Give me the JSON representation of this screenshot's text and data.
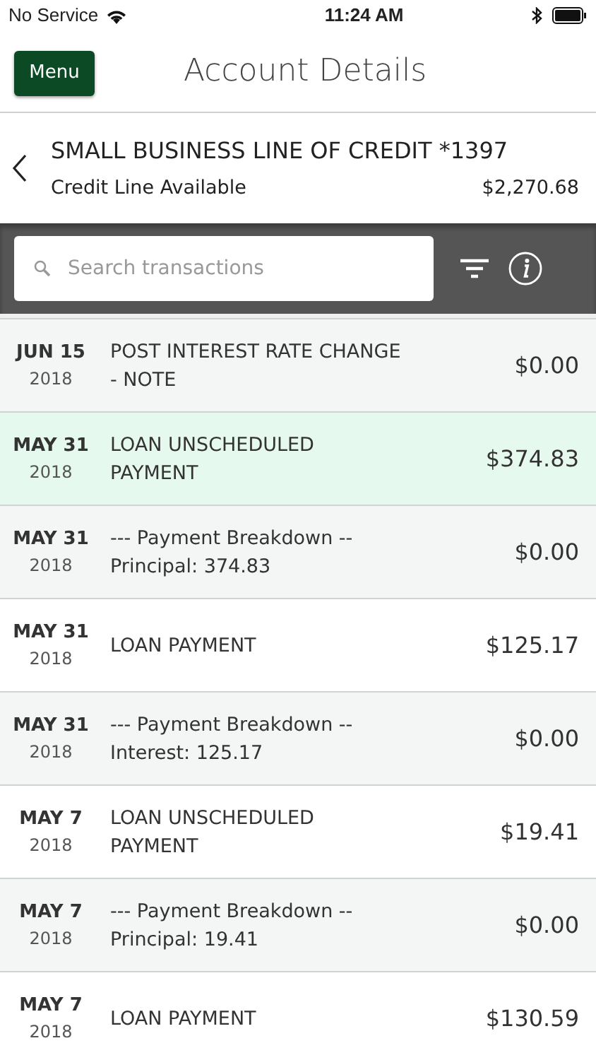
{
  "status_bar": {
    "carrier": "No Service",
    "time": "11:24 AM"
  },
  "header": {
    "menu_button": "Menu",
    "title": "Account Details"
  },
  "account": {
    "name": "SMALL BUSINESS LINE OF CREDIT *1397",
    "label": "Credit Line Available",
    "amount": "$2,270.68"
  },
  "search": {
    "placeholder": "Search transactions"
  },
  "transactions": [
    {
      "month_day": "JUN 15",
      "year": "2018",
      "lines": [
        "POST INTEREST RATE CHANGE",
        "- NOTE"
      ],
      "amount": "$0.00",
      "selected": false
    },
    {
      "month_day": "MAY 31",
      "year": "2018",
      "lines": [
        "LOAN UNSCHEDULED",
        "PAYMENT"
      ],
      "amount": "$374.83",
      "selected": true
    },
    {
      "month_day": "MAY 31",
      "year": "2018",
      "lines": [
        "--- Payment Breakdown --",
        "Principal: 374.83"
      ],
      "amount": "$0.00",
      "selected": false
    },
    {
      "month_day": "MAY 31",
      "year": "2018",
      "lines": [
        "LOAN PAYMENT"
      ],
      "amount": "$125.17",
      "selected": false
    },
    {
      "month_day": "MAY 31",
      "year": "2018",
      "lines": [
        "--- Payment Breakdown --",
        "Interest: 125.17"
      ],
      "amount": "$0.00",
      "selected": false
    },
    {
      "month_day": "MAY 7",
      "year": "2018",
      "lines": [
        "LOAN UNSCHEDULED",
        "PAYMENT"
      ],
      "amount": "$19.41",
      "selected": false
    },
    {
      "month_day": "MAY 7",
      "year": "2018",
      "lines": [
        "--- Payment Breakdown --",
        "Principal: 19.41"
      ],
      "amount": "$0.00",
      "selected": false
    },
    {
      "month_day": "MAY 7",
      "year": "2018",
      "lines": [
        "LOAN PAYMENT"
      ],
      "amount": "$130.59",
      "selected": false
    }
  ]
}
